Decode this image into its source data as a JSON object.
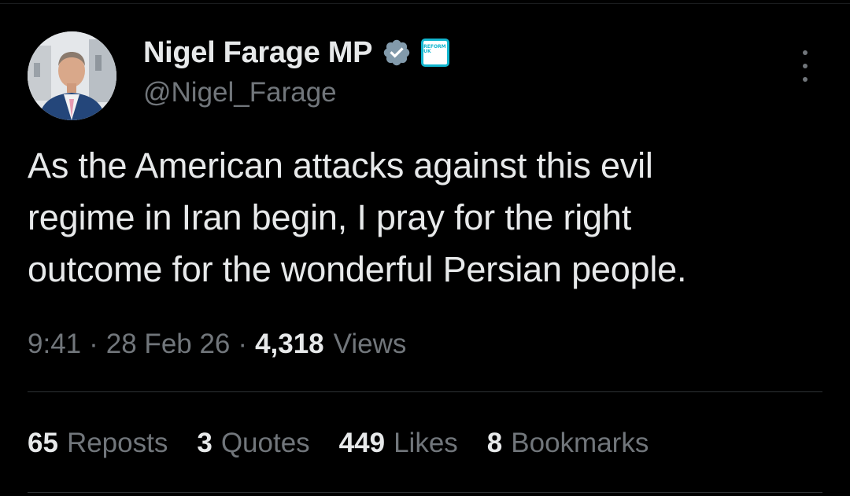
{
  "author": {
    "display_name": "Nigel Farage MP",
    "handle": "@Nigel_Farage",
    "avatar_icon": "profile-photo",
    "verified_icon": "verified-badge-icon",
    "affiliate_badge_text": "REFORM UK",
    "affiliate_badge_color": "#12b6cf",
    "verified_color": "#829aab"
  },
  "tweet": {
    "text_lines": [
      "As the American attacks against this evil",
      "regime in Iran begin, I pray for the right",
      "outcome for the wonderful Persian people."
    ],
    "time": "9:41",
    "date": "28 Feb 26",
    "separator": "·",
    "views_count": "4,318",
    "views_label": "Views"
  },
  "stats": [
    {
      "count": "65",
      "label": "Reposts"
    },
    {
      "count": "3",
      "label": "Quotes"
    },
    {
      "count": "449",
      "label": "Likes"
    },
    {
      "count": "8",
      "label": "Bookmarks"
    }
  ],
  "more_icon": "more-options-icon",
  "colors": {
    "background": "#000000",
    "primary_text": "#e7e9ea",
    "secondary_text": "#71767b",
    "divider": "#2f3336"
  }
}
